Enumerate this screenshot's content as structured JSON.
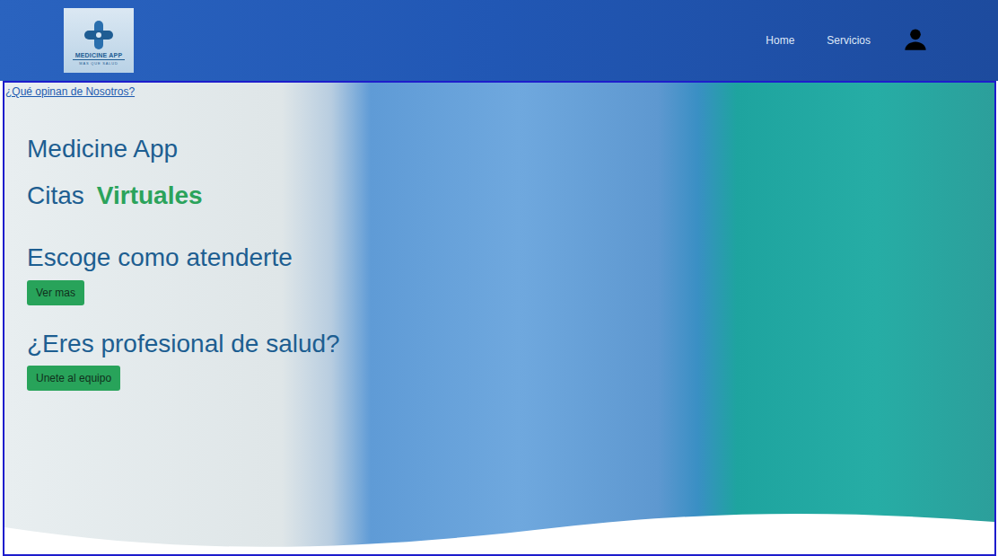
{
  "header": {
    "logo": {
      "title": "MEDICINE APP",
      "tagline": "MAS QUE SALUD"
    },
    "nav": [
      {
        "label": "Home"
      },
      {
        "label": "Servicios"
      }
    ]
  },
  "hero": {
    "reviews_link": "¿Qué opinan de Nosotros?",
    "title": "Medicine App",
    "subtitle": {
      "text": "Citas",
      "highlight": "Virtuales"
    },
    "sections": [
      {
        "heading": "Escoge como atenderte",
        "button": "Ver mas"
      },
      {
        "heading": "¿Eres profesional de salud?",
        "button": "Unete al equipo"
      }
    ]
  }
}
